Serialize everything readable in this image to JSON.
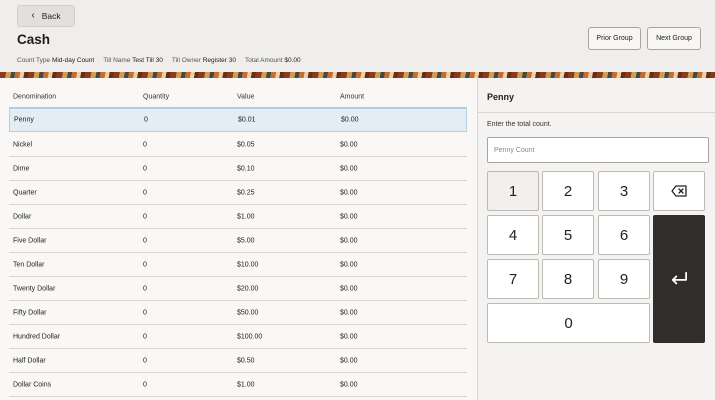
{
  "header": {
    "back_label": "Back",
    "title": "Cash",
    "meta": [
      {
        "label": "Count Type",
        "value": "Mid-day Count"
      },
      {
        "label": "Till Name",
        "value": "Test Till 30"
      },
      {
        "label": "Till Owner",
        "value": "Register 30"
      },
      {
        "label": "Total Amount",
        "value": "$0.00"
      }
    ],
    "prior_group_label": "Prior Group",
    "next_group_label": "Next Group"
  },
  "table": {
    "columns": [
      "Denomination",
      "Quantity",
      "Value",
      "Amount"
    ],
    "rows": [
      {
        "denomination": "Penny",
        "quantity": "0",
        "value": "$0.01",
        "amount": "$0.00"
      },
      {
        "denomination": "Nickel",
        "quantity": "0",
        "value": "$0.05",
        "amount": "$0.00"
      },
      {
        "denomination": "Dime",
        "quantity": "0",
        "value": "$0.10",
        "amount": "$0.00"
      },
      {
        "denomination": "Quarter",
        "quantity": "0",
        "value": "$0.25",
        "amount": "$0.00"
      },
      {
        "denomination": "Dollar",
        "quantity": "0",
        "value": "$1.00",
        "amount": "$0.00"
      },
      {
        "denomination": "Five Dollar",
        "quantity": "0",
        "value": "$5.00",
        "amount": "$0.00"
      },
      {
        "denomination": "Ten Dollar",
        "quantity": "0",
        "value": "$10.00",
        "amount": "$0.00"
      },
      {
        "denomination": "Twenty Dollar",
        "quantity": "0",
        "value": "$20.00",
        "amount": "$0.00"
      },
      {
        "denomination": "Fifty Dollar",
        "quantity": "0",
        "value": "$50.00",
        "amount": "$0.00"
      },
      {
        "denomination": "Hundred Dollar",
        "quantity": "0",
        "value": "$100.00",
        "amount": "$0.00"
      },
      {
        "denomination": "Half Dollar",
        "quantity": "0",
        "value": "$0.50",
        "amount": "$0.00"
      },
      {
        "denomination": "Dollar Coins",
        "quantity": "0",
        "value": "$1.00",
        "amount": "$0.00"
      }
    ],
    "selected_denomination": "Penny"
  },
  "panel": {
    "title": "Penny",
    "prompt": "Enter the total count.",
    "input_value": "",
    "input_placeholder": "Penny Count"
  },
  "keypad": {
    "digits": [
      "1",
      "2",
      "3",
      "4",
      "5",
      "6",
      "7",
      "8",
      "9",
      "0"
    ],
    "backspace_icon": "backspace-icon",
    "enter_icon": "enter-return-icon"
  },
  "colors": {
    "selected_row": "#e3eef4",
    "enter_key": "#312d2a"
  }
}
